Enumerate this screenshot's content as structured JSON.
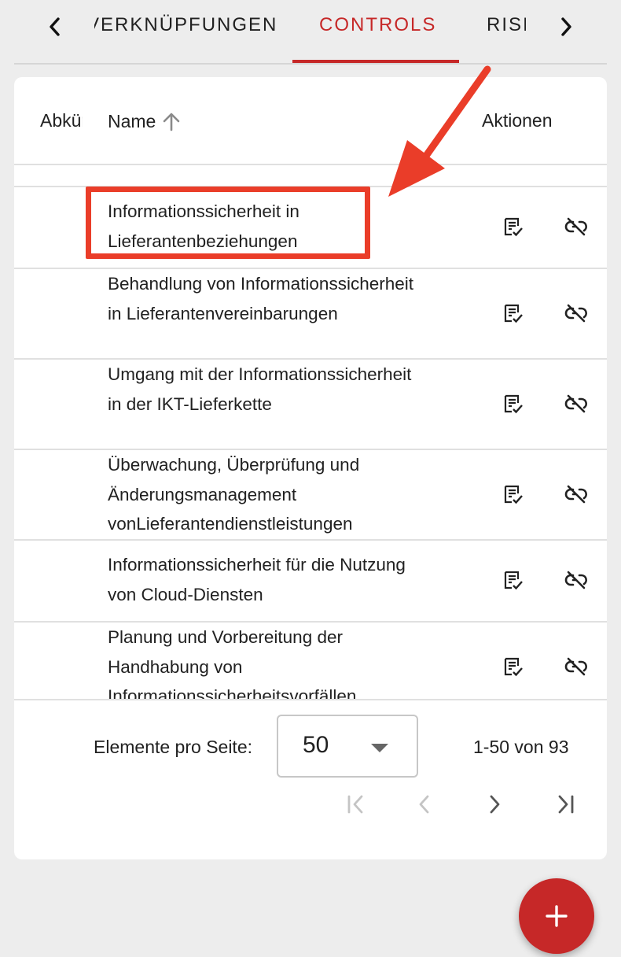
{
  "tabs": {
    "items": [
      {
        "label": "VERKNÜPFUNGEN",
        "active": false
      },
      {
        "label": "CONTROLS",
        "active": true
      },
      {
        "label": "RISIKEN",
        "active": false
      }
    ],
    "active_color": "#c62828"
  },
  "table": {
    "columns": {
      "abbreviation": "Abkürzung",
      "name": "Name",
      "actions": "Aktionen"
    },
    "sort": {
      "column": "name",
      "direction": "ascending",
      "icon": "arrow-up-icon"
    },
    "rows": [
      {
        "abbreviation": "",
        "name": ""
      },
      {
        "abbreviation": "",
        "name": "Informationssicherheit in Lieferantenbeziehungen",
        "highlighted": true
      },
      {
        "abbreviation": "",
        "name": "Behandlung von Informationssicherheit in Lieferantenvereinbarungen"
      },
      {
        "abbreviation": "",
        "name": "Umgang mit der Informationssicherheit in der IKT-Lieferkette"
      },
      {
        "abbreviation": "",
        "name": "Überwachung, Überprüfung und Änderungsmanagement vonLieferantendienstleistungen"
      },
      {
        "abbreviation": "",
        "name": "Informationssicherheit für die Nutzung von Cloud-Diensten"
      },
      {
        "abbreviation": "",
        "name": "Planung und Vorbereitung der Handhabung von Informationssicherheitsvorfällen"
      }
    ],
    "row_actions": [
      {
        "name": "edit-checklist-icon"
      },
      {
        "name": "unlink-icon"
      }
    ]
  },
  "paginator": {
    "per_page_label": "Elemente pro Seite:",
    "per_page_value": "50",
    "range_label": "1-50 von 93"
  },
  "annotation": {
    "color": "#ea3d29"
  },
  "fab": {
    "icon": "plus-icon",
    "color": "#c62828"
  }
}
